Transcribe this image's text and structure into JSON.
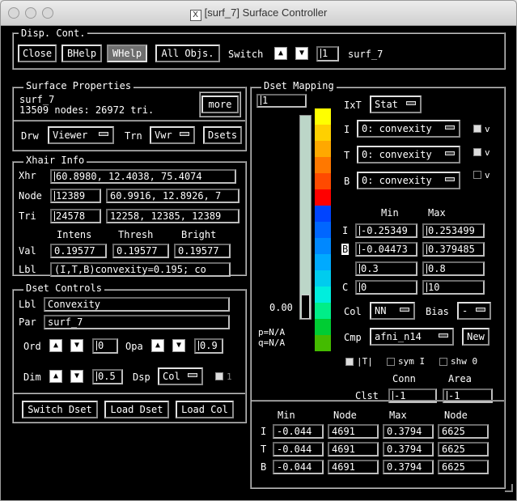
{
  "window": {
    "title": "[surf_7] Surface Controller",
    "xicon": "X"
  },
  "disp_cont": {
    "legend": "Disp. Cont.",
    "close": "Close",
    "bhelp": "BHelp",
    "whelp": "WHelp",
    "all_objs": "All Objs.",
    "switch_label": "Switch",
    "switch_value": "1",
    "surf_name": "surf_7"
  },
  "surface_properties": {
    "legend": "Surface Properties",
    "name": "surf_7",
    "info": "13509 nodes: 26972 tri.",
    "more": "more",
    "drw_label": "Drw",
    "drw_value": "Viewer",
    "trn_label": "Trn",
    "trn_value": "Vwr",
    "dsets": "Dsets"
  },
  "xhair": {
    "legend": "Xhair Info",
    "xhr_label": "Xhr",
    "xhr_value": "60.8980, 12.4038, 75.4074",
    "node_label": "Node",
    "node_value": "12389",
    "node_xyz": "60.9916, 12.8926, 7",
    "tri_label": "Tri",
    "tri_value": "24578",
    "tri_nodes": "12258, 12385, 12389",
    "h_intens": "Intens",
    "h_thresh": "Thresh",
    "h_bright": "Bright",
    "val_label": "Val",
    "val_intens": "0.19577",
    "val_thresh": "0.19577",
    "val_bright": "0.19577",
    "lbl_label": "Lbl",
    "lbl_value": "(I,T,B)convexity=0.195; co"
  },
  "dset_controls": {
    "legend": "Dset Controls",
    "lbl_label": "Lbl",
    "lbl_value": "Convexity",
    "par_label": "Par",
    "par_value": "surf_7",
    "ord_label": "Ord",
    "ord_value": "0",
    "opa_label": "Opa",
    "opa_value": "0.9",
    "dim_label": "Dim",
    "dim_value": "0.5",
    "dsp_label": "Dsp",
    "dsp_value": "Col",
    "one_label": "1",
    "switch_dset": "Switch Dset",
    "load_dset": "Load Dset",
    "load_col": "Load Col"
  },
  "dset_mapping": {
    "legend": "Dset Mapping",
    "scale_top": "1",
    "scale_value": "0.00",
    "p_value": "p=N/A",
    "q_value": "q=N/A",
    "ixt_label": "IxT",
    "ixt_value": "Stat",
    "i_label": "I",
    "i_value": "0: convexity",
    "i_v": "v",
    "t_label": "T",
    "t_value": "0: convexity",
    "t_v": "v",
    "b_label": "B",
    "b_value": "0: convexity",
    "b_v": "v",
    "min_header": "Min",
    "max_header": "Max",
    "range_i_label": "I",
    "range_i_min": "-0.25349",
    "range_i_max": "0.253499",
    "range_b_label": "B",
    "range_b_min": "-0.04473",
    "range_b_max": "0.379485",
    "range_3_min": "0.3",
    "range_3_max": "0.8",
    "range_c_label": "C",
    "range_c_min": "0",
    "range_c_max": "10",
    "col_label": "Col",
    "col_value": "NN",
    "bias_label": "Bias",
    "bias_value": "-",
    "cmp_label": "Cmp",
    "cmp_value": "afni_n14",
    "new": "New",
    "abs_label": "|T|",
    "sym_label": "sym I",
    "shw_label": "shw 0",
    "conn_header": "Conn",
    "area_header": "Area",
    "clst_label": "Clst",
    "conn_value": "-1",
    "area_value": "-1",
    "colorbar": [
      "#ffff00",
      "#ffd000",
      "#ffa800",
      "#ff7800",
      "#ff4a00",
      "#ff0000",
      "#0044ff",
      "#0066ff",
      "#0088ff",
      "#00aaff",
      "#00ccee",
      "#00eedd",
      "#00ee88",
      "#00cc33",
      "#44bb00"
    ],
    "table": {
      "headers": [
        "Min",
        "Node",
        "Max",
        "Node"
      ],
      "rows": [
        {
          "label": "I",
          "min": "-0.044",
          "node1": "4691",
          "max": "0.3794",
          "node2": "6625"
        },
        {
          "label": "T",
          "min": "-0.044",
          "node1": "4691",
          "max": "0.3794",
          "node2": "6625"
        },
        {
          "label": "B",
          "min": "-0.044",
          "node1": "4691",
          "max": "0.3794",
          "node2": "6625"
        }
      ]
    }
  }
}
